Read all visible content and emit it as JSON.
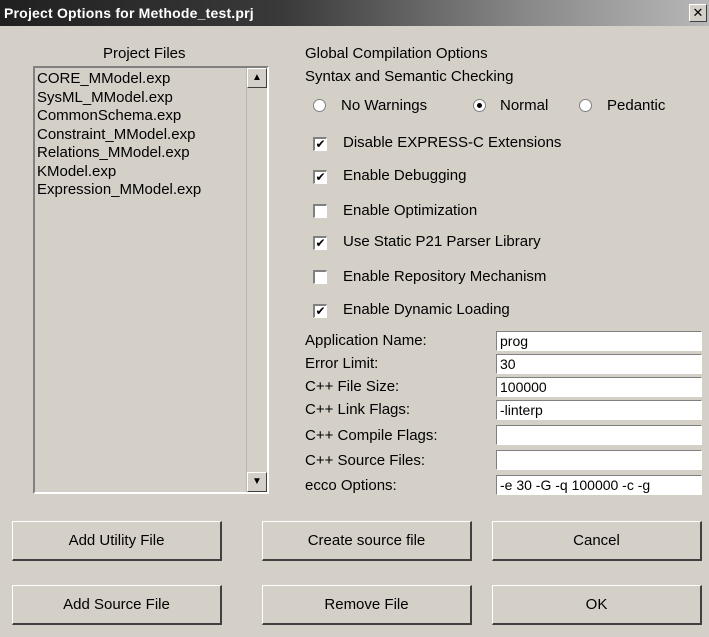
{
  "window": {
    "title": "Project Options for Methode_test.prj",
    "close_glyph": "✕"
  },
  "project_files": {
    "heading": "Project Files",
    "items": [
      "CORE_MModel.exp",
      "SysML_MModel.exp",
      "CommonSchema.exp",
      "Constraint_MModel.exp",
      "Relations_MModel.exp",
      "KModel.exp",
      "Expression_MModel.exp"
    ],
    "scroll_up_icon": "scroll-up-arrow",
    "scroll_down_icon": "scroll-down-arrow"
  },
  "global": {
    "heading": "Global Compilation Options",
    "syntax_heading": "Syntax and Semantic Checking",
    "radios": [
      {
        "label": "No Warnings",
        "checked": false
      },
      {
        "label": "Normal",
        "checked": true
      },
      {
        "label": "Pedantic",
        "checked": false
      }
    ],
    "checkboxes": [
      {
        "label": "Disable EXPRESS-C Extensions",
        "checked": true
      },
      {
        "label": "Enable Debugging",
        "checked": true
      },
      {
        "label": "Enable Optimization",
        "checked": false
      },
      {
        "label": "Use Static P21 Parser Library",
        "checked": true
      },
      {
        "label": "Enable Repository Mechanism",
        "checked": false
      },
      {
        "label": "Enable Dynamic Loading",
        "checked": true
      }
    ],
    "check_mark": "✔"
  },
  "fields": [
    {
      "label": "Application Name:",
      "value": "prog"
    },
    {
      "label": "Error Limit:",
      "value": "30"
    },
    {
      "label": "C++ File Size:",
      "value": "100000"
    },
    {
      "label": "C++ Link Flags:",
      "value": "-linterp"
    },
    {
      "label": "C++ Compile Flags:",
      "value": ""
    },
    {
      "label": "C++ Source Files:",
      "value": ""
    },
    {
      "label": "ecco Options:",
      "value": "-e 30 -G -q 100000 -c -g"
    }
  ],
  "buttons": {
    "add_utility": "Add Utility File",
    "create_source": "Create source file",
    "cancel": "Cancel",
    "add_source": "Add Source File",
    "remove_file": "Remove File",
    "ok": "OK"
  }
}
